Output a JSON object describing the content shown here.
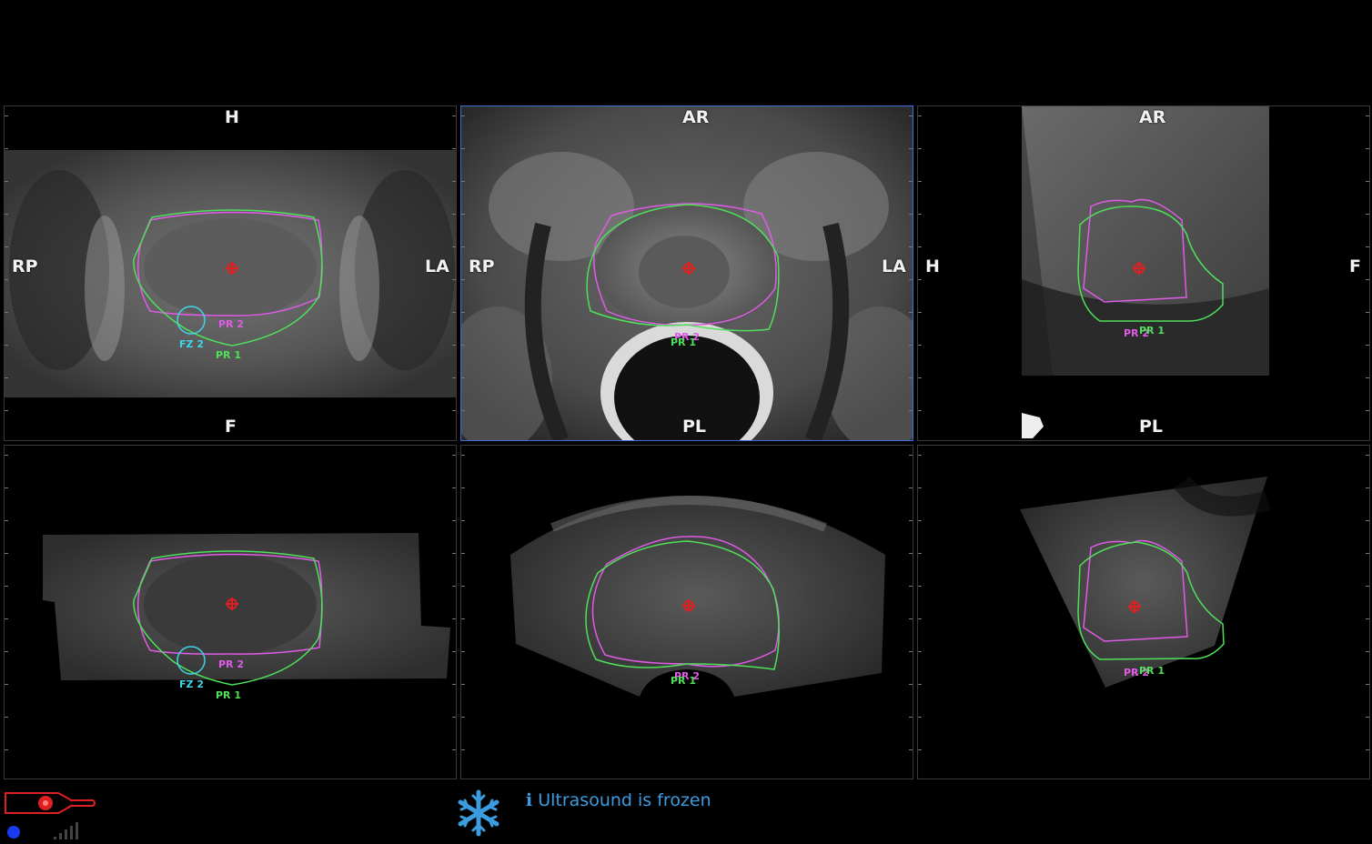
{
  "panels": [
    {
      "id": "mri-coronal",
      "top": "H",
      "bottom": "F",
      "left": "RP",
      "right": "LA",
      "contours": [
        "PR 2",
        "PR 1",
        "FZ 2"
      ]
    },
    {
      "id": "mri-axial",
      "top": "AR",
      "bottom": "PL",
      "left": "RP",
      "right": "LA",
      "contours": [
        "PR 2",
        "PR 1"
      ]
    },
    {
      "id": "mri-sagittal",
      "top": "AR",
      "bottom": "PL",
      "left": "H",
      "right": "F",
      "contours": [
        "PR 2",
        "PR 1"
      ]
    },
    {
      "id": "us-coronal",
      "contours": [
        "PR 2",
        "PR 1",
        "FZ 2"
      ]
    },
    {
      "id": "us-axial",
      "contours": [
        "PR 2",
        "PR 1"
      ]
    },
    {
      "id": "us-sagittal",
      "contours": [
        "PR 2",
        "PR 1"
      ]
    }
  ],
  "colors": {
    "contour_pr1": "#4fe05a",
    "contour_pr2": "#e05be6",
    "contour_fz2": "#3fd6e8",
    "target": "#e02020",
    "active_border": "#3f6fd8",
    "status_text": "#3d9be0"
  },
  "status": {
    "message": "Ultrasound is frozen",
    "info_icon": "info-icon",
    "freeze_icon": "snowflake-icon",
    "probe_icon": "ultrasound-probe-icon",
    "signal_icon": "signal-bars-icon"
  }
}
